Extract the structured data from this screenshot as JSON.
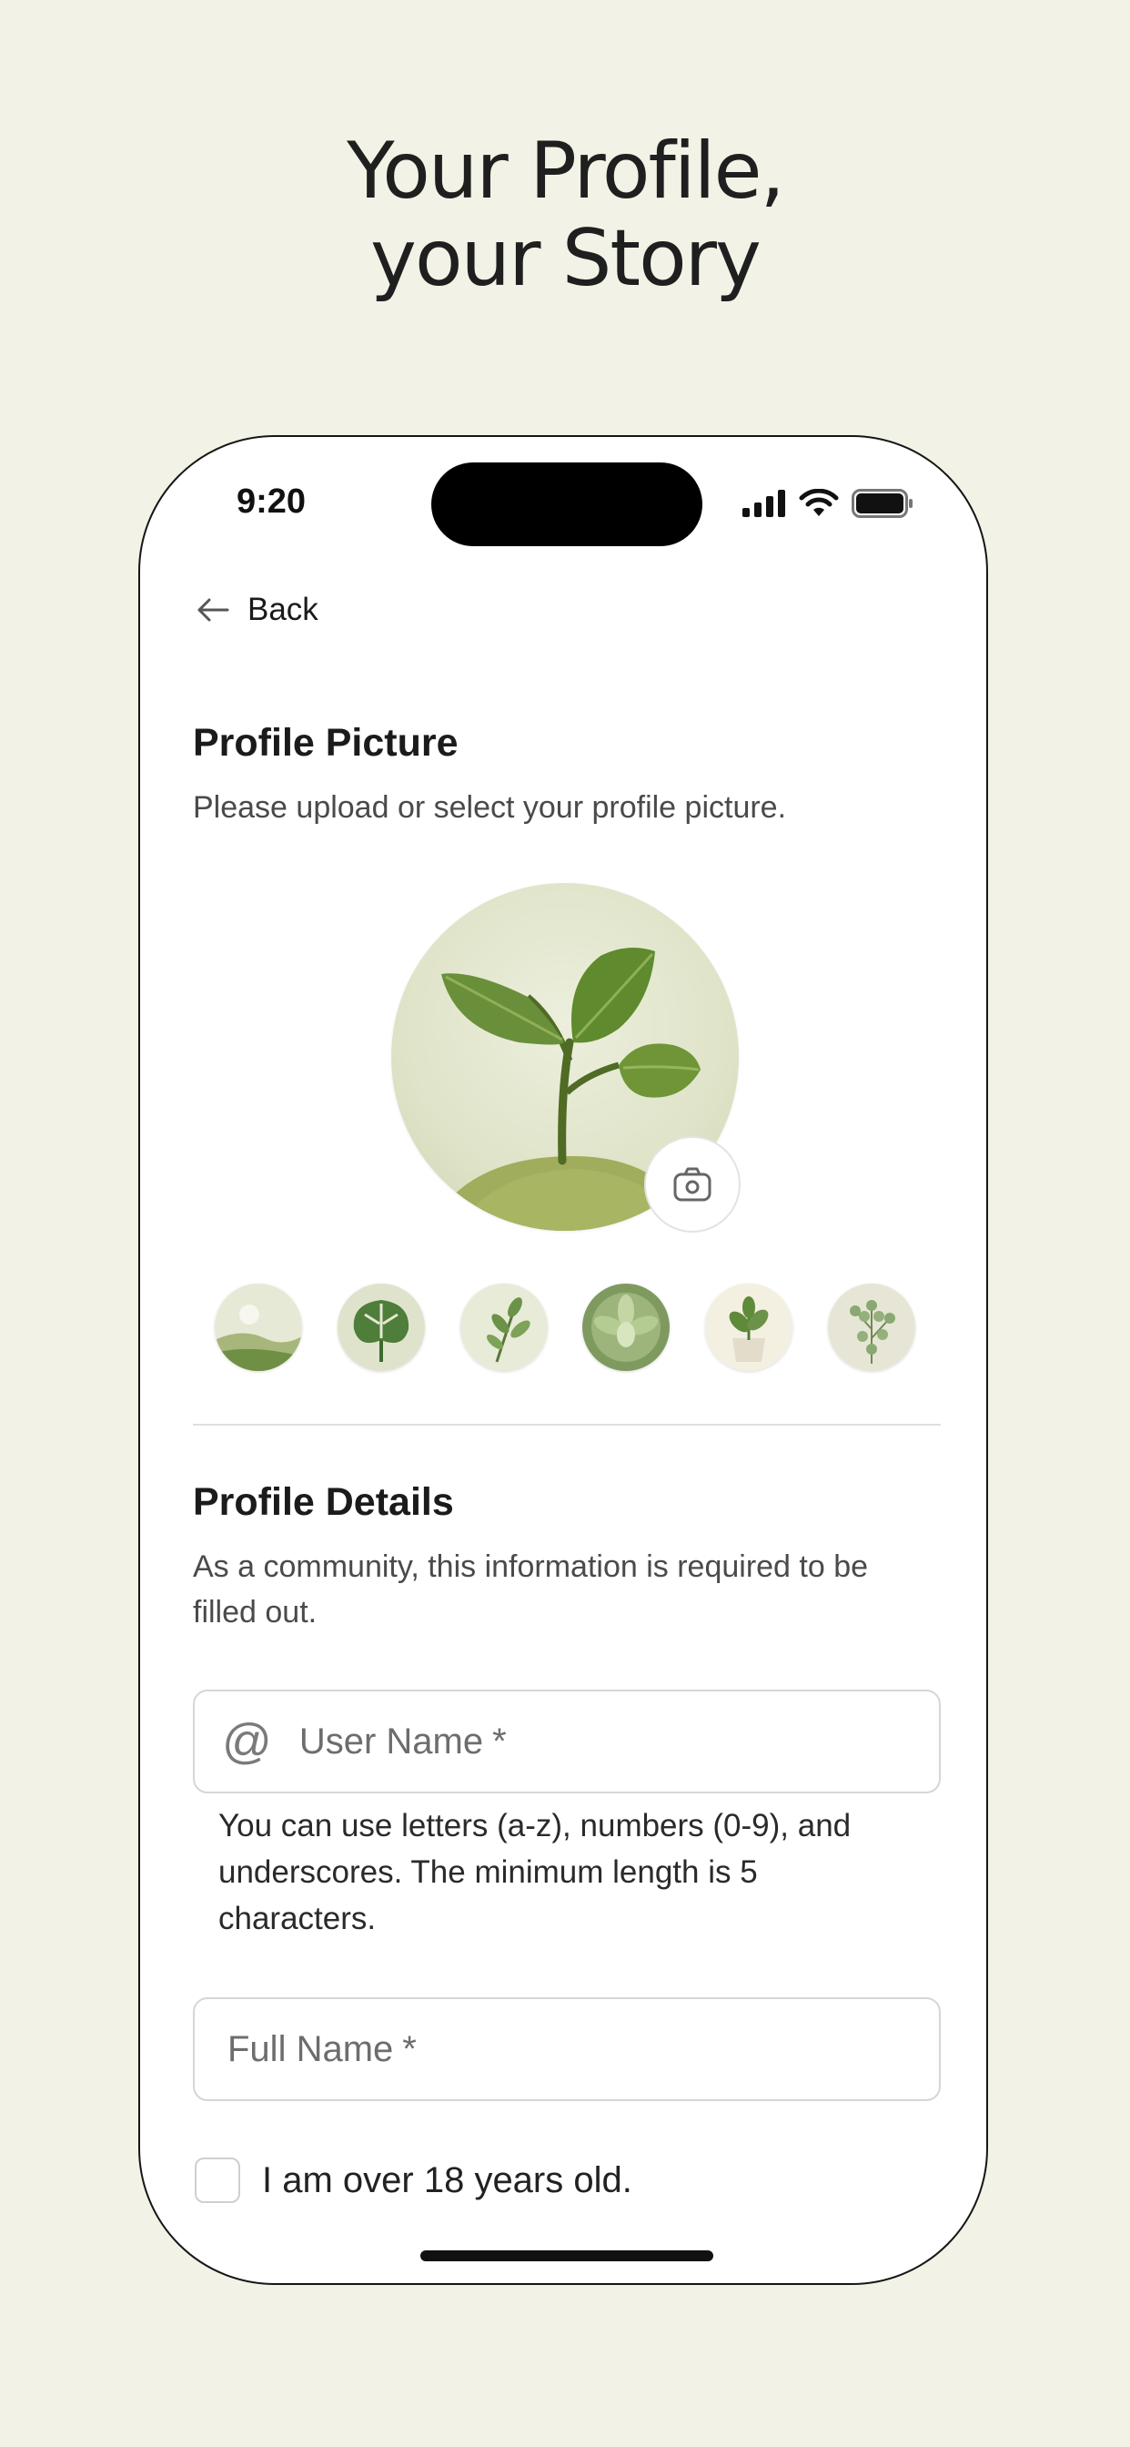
{
  "headline": {
    "line1": "Your Profile,",
    "line2": "your Story"
  },
  "status_bar": {
    "time": "9:20"
  },
  "nav": {
    "back_label": "Back"
  },
  "profile_picture": {
    "title": "Profile Picture",
    "subtitle": "Please upload or select your profile picture."
  },
  "avatar_options": [
    "landscape",
    "monstera-leaf",
    "herb-sprig",
    "succulent",
    "potted-plant",
    "eucalyptus"
  ],
  "profile_details": {
    "title": "Profile Details",
    "subtitle": "As a community, this information is required to be filled out."
  },
  "form": {
    "username_placeholder": "User Name",
    "required_mark": "*",
    "username_hint": "You can use letters (a-z), numbers (0-9), and underscores. The minimum length is 5 characters.",
    "fullname_placeholder": "Full Name",
    "age_checkbox_label": "I am over 18 years old."
  },
  "colors": {
    "background": "#f2f2e6",
    "required": "#c2314e",
    "leaf": "#6a8f3a"
  }
}
